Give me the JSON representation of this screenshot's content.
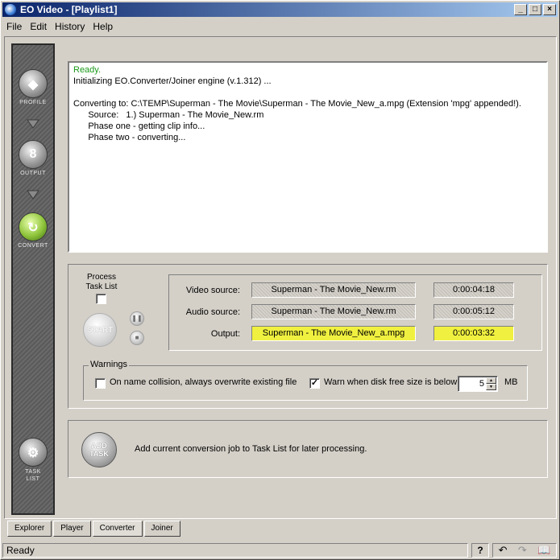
{
  "window": {
    "title": "EO Video - [Playlist1]",
    "minimize": "_",
    "maximize": "□",
    "close": "×"
  },
  "menu": {
    "file": "File",
    "edit": "Edit",
    "history": "History",
    "help": "Help"
  },
  "sidebar": {
    "profile": "PROFILE",
    "output": "OUTPUT",
    "convert": "CONVERT",
    "task_list": "TASK LIST"
  },
  "log": {
    "lines": [
      "Ready.",
      "Initializing EO.Converter/Joiner engine (v.1.312) ...",
      "",
      "Converting to: C:\\TEMP\\Superman - The Movie\\Superman - The Movie_New_a.mpg (Extension 'mpg' appended!).",
      "      Source:   1.) Superman - The Movie_New.rm",
      "      Phase one - getting clip info...",
      "      Phase two - converting..."
    ]
  },
  "process": {
    "label_line1": "Process",
    "label_line2": "Task List",
    "checked": false,
    "start": "START",
    "pause_icon": "pause-icon",
    "stop_icon": "stop-icon"
  },
  "sources": {
    "video_label": "Video source:",
    "video_value": "Superman - The Movie_New.rm",
    "video_time": "0:00:04:18",
    "audio_label": "Audio source:",
    "audio_value": "Superman - The Movie_New.rm",
    "audio_time": "0:00:05:12",
    "output_label": "Output:",
    "output_value": "Superman - The Movie_New_a.mpg",
    "output_time": "0:00:03:32",
    "highlight_color": "#f0f040"
  },
  "warnings": {
    "legend": "Warnings",
    "overwrite_label": "On name collision, always overwrite existing file",
    "overwrite_checked": false,
    "diskfree_label": "Warn when disk free size is below",
    "diskfree_checked": true,
    "diskfree_value": "5",
    "diskfree_unit": "MB"
  },
  "addtask": {
    "button_line1": "ADD",
    "button_line2": "TASK",
    "description": "Add current conversion job to Task List for later processing."
  },
  "tabs": [
    "Explorer",
    "Player",
    "Converter",
    "Joiner"
  ],
  "status": {
    "text": "Ready",
    "help": "?"
  }
}
